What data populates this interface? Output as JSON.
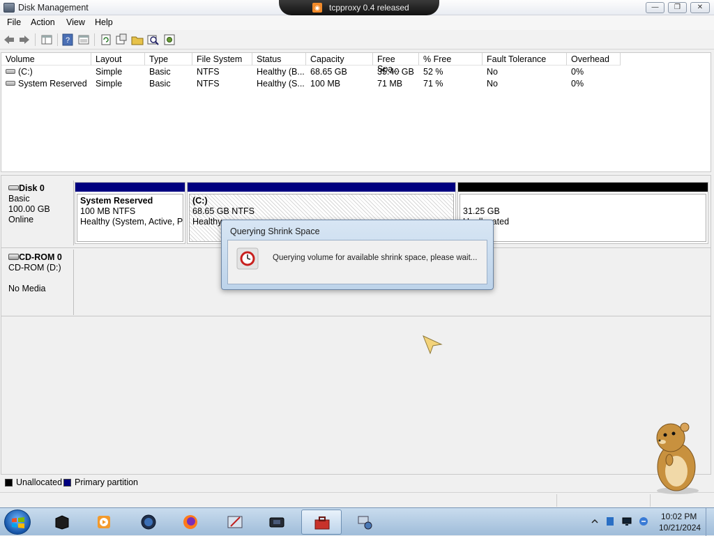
{
  "window": {
    "title": "Disk Management"
  },
  "notification": {
    "text": "tcpproxy 0.4 released"
  },
  "menu": [
    "File",
    "Action",
    "View",
    "Help"
  ],
  "toolbar_icons": [
    "back-icon",
    "forward-icon",
    "console-tree-icon",
    "help-icon",
    "properties-icon",
    "refresh-icon",
    "rescan-icon",
    "open-icon",
    "search-icon",
    "settings-icon"
  ],
  "columns": [
    "Volume",
    "Layout",
    "Type",
    "File System",
    "Status",
    "Capacity",
    "Free Spa...",
    "% Free",
    "Fault Tolerance",
    "Overhead"
  ],
  "volumes": [
    [
      "(C:)",
      "Simple",
      "Basic",
      "NTFS",
      "Healthy (B...",
      "68.65 GB",
      "35.40 GB",
      "52 %",
      "No",
      "0%"
    ],
    [
      "System Reserved",
      "Simple",
      "Basic",
      "NTFS",
      "Healthy (S...",
      "100 MB",
      "71 MB",
      "71 %",
      "No",
      "0%"
    ]
  ],
  "disks": [
    {
      "name": "Disk 0",
      "type": "Basic",
      "size": "100.00 GB",
      "state": "Online",
      "partitions": [
        {
          "title": "System Reserved",
          "size": "100 MB NTFS",
          "status": "Healthy (System, Active, Pri",
          "kind": "primary"
        },
        {
          "title": "(C:)",
          "size": "68.65 GB NTFS",
          "status": "Healthy",
          "kind": "primary"
        },
        {
          "title": "",
          "size": "31.25 GB",
          "status": "Unallocated",
          "kind": "unallocated"
        }
      ]
    },
    {
      "name": "CD-ROM 0",
      "type": "CD-ROM (D:)",
      "state": "No Media"
    }
  ],
  "legend": [
    {
      "label": "Unallocated",
      "color": "#000000"
    },
    {
      "label": "Primary partition",
      "color": "#000080"
    }
  ],
  "dialog": {
    "title": "Querying Shrink Space",
    "message": "Querying volume for available shrink space, please wait..."
  },
  "taskbar": {
    "items": [
      "terminal-icon",
      "media-player-icon",
      "browser-icon",
      "firefox-icon",
      "editor-icon",
      "display-icon",
      "toolbox-icon",
      "network-icon"
    ],
    "active_index": 6,
    "time": "10:02 PM",
    "date": "10/21/2024"
  },
  "colors": {
    "primary": "#000080",
    "unallocated": "#000000",
    "accent": "#c9dcee"
  }
}
